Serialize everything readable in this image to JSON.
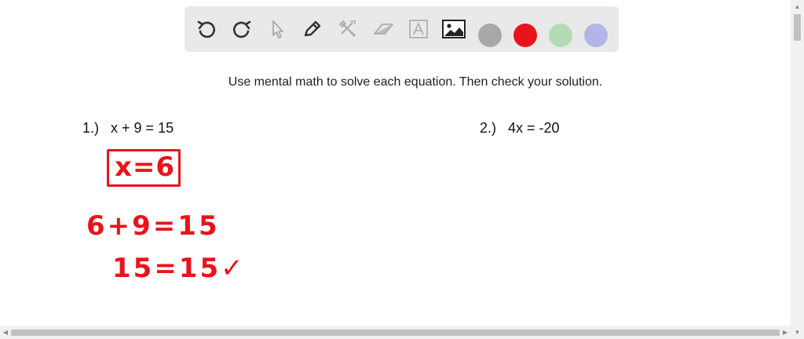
{
  "toolbar": {
    "tools": [
      {
        "name": "undo-icon",
        "enabled": true
      },
      {
        "name": "redo-icon",
        "enabled": true
      },
      {
        "name": "pointer-icon",
        "enabled": false
      },
      {
        "name": "pen-icon",
        "enabled": true
      },
      {
        "name": "tools-icon",
        "enabled": false
      },
      {
        "name": "eraser-icon",
        "enabled": false
      },
      {
        "name": "text-icon",
        "enabled": false
      },
      {
        "name": "image-icon",
        "enabled": true
      }
    ],
    "colors": [
      "#a8a8a8",
      "#e8141c",
      "#b4dbb6",
      "#b4b4e8"
    ]
  },
  "instructions": "Use mental math to solve each equation. Then check your solution.",
  "problems": [
    {
      "number": "1.)",
      "equation": "x + 9 = 15"
    },
    {
      "number": "2.)",
      "equation": "4x = -20"
    }
  ],
  "handwriting": {
    "answer": "x=6",
    "check_line_1": "6+9=15",
    "check_line_2": "15=15",
    "check_mark": "✓"
  }
}
